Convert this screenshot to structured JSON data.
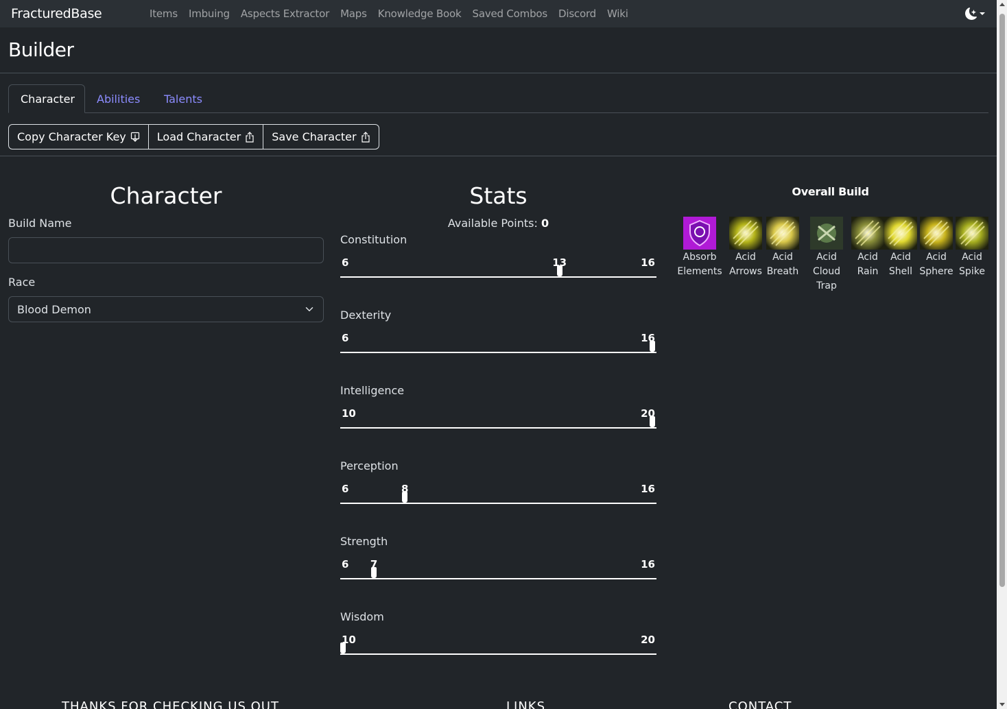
{
  "nav": {
    "brand": "FracturedBase",
    "links": [
      "Items",
      "Imbuing",
      "Aspects Extractor",
      "Maps",
      "Knowledge Book",
      "Saved Combos",
      "Discord",
      "Wiki"
    ],
    "theme_icon": "moon-stars-icon"
  },
  "page": {
    "title": "Builder"
  },
  "tabs": [
    {
      "label": "Character",
      "active": true
    },
    {
      "label": "Abilities",
      "active": false
    },
    {
      "label": "Talents",
      "active": false
    }
  ],
  "actions": {
    "copy_label": "Copy Character Key",
    "load_label": "Load Character",
    "save_label": "Save Character",
    "copy_icon": "clipboard-download-icon",
    "share_icon": "box-arrow-up-icon"
  },
  "character": {
    "title": "Character",
    "build_name_label": "Build Name",
    "build_name_value": "",
    "race_label": "Race",
    "race_value": "Blood Demon"
  },
  "stats": {
    "title": "Stats",
    "available_label": "Available Points:",
    "available_value": "0",
    "items": [
      {
        "name": "Constitution",
        "min": "6",
        "max": "16",
        "value": "13",
        "show_value": true
      },
      {
        "name": "Dexterity",
        "min": "6",
        "max": "16",
        "value": "16",
        "show_value": false
      },
      {
        "name": "Intelligence",
        "min": "10",
        "max": "20",
        "value": "20",
        "show_value": false
      },
      {
        "name": "Perception",
        "min": "6",
        "max": "16",
        "value": "8",
        "show_value": true
      },
      {
        "name": "Strength",
        "min": "6",
        "max": "16",
        "value": "7",
        "show_value": true
      },
      {
        "name": "Wisdom",
        "min": "10",
        "max": "20",
        "value": "10",
        "show_value": false
      }
    ]
  },
  "overall_build": {
    "title": "Overall Build",
    "abilities": [
      {
        "name_line1": "Absorb",
        "name_line2": "Elements",
        "name_line3": "",
        "icon": "absorb-elements-icon",
        "color": "#c21ee0"
      },
      {
        "name_line1": "Acid",
        "name_line2": "Arrows",
        "name_line3": "",
        "icon": "acid-arrows-icon",
        "color": "#b5b51a"
      },
      {
        "name_line1": "Acid",
        "name_line2": "Breath",
        "name_line3": "",
        "icon": "acid-breath-icon",
        "color": "#d9c84a"
      },
      {
        "name_line1": "Acid",
        "name_line2": "Cloud",
        "name_line3": "Trap",
        "icon": "acid-cloud-trap-icon",
        "color": "#6b8a55"
      },
      {
        "name_line1": "Acid",
        "name_line2": "Rain",
        "name_line3": "",
        "icon": "acid-rain-icon",
        "color": "#8a8f3a"
      },
      {
        "name_line1": "Acid",
        "name_line2": "Shell",
        "name_line3": "",
        "icon": "acid-shell-icon",
        "color": "#e0d830"
      },
      {
        "name_line1": "Acid",
        "name_line2": "Sphere",
        "name_line3": "",
        "icon": "acid-sphere-icon",
        "color": "#c9b41c"
      },
      {
        "name_line1": "Acid",
        "name_line2": "Spike",
        "name_line3": "",
        "icon": "acid-spike-icon",
        "color": "#a8b020"
      }
    ]
  },
  "footer": {
    "thanks": "THANKS FOR CHECKING US OUT",
    "links": "LINKS",
    "contact": "CONTACT"
  }
}
